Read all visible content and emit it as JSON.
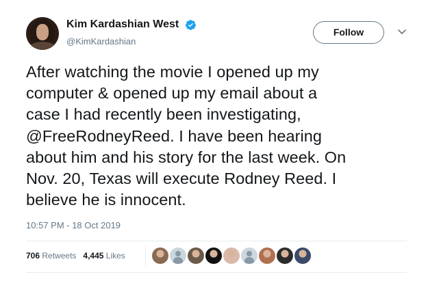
{
  "user": {
    "display_name": "Kim Kardashian West",
    "handle": "@KimKardashian",
    "verified": true
  },
  "follow_button": {
    "label": "Follow"
  },
  "tweet": {
    "lines": [
      "After watching the movie I opened up my",
      "computer & opened up my email about a",
      "case I had recently been investigating,",
      "@FreeRodneyReed. I have been hearing",
      "about him and his story for the last week. On",
      "Nov. 20, Texas will execute Rodney Reed. I",
      "believe he is innocent."
    ],
    "mention": "@FreeRodneyReed",
    "timestamp": "10:57 PM - 18 Oct 2019"
  },
  "stats": {
    "retweets_count": "706",
    "retweets_label": "Retweets",
    "likes_count": "4,445",
    "likes_label": "Likes"
  },
  "likers": [
    {
      "icon": "liker-avatar-1",
      "color": "#8a6a52"
    },
    {
      "icon": "default-avatar-icon",
      "color": "#ccd6dd"
    },
    {
      "icon": "liker-avatar-3",
      "color": "#6b5a4a"
    },
    {
      "icon": "liker-avatar-4",
      "color": "#111111"
    },
    {
      "icon": "liker-avatar-5",
      "color": "#d8b9aa"
    },
    {
      "icon": "default-avatar-icon",
      "color": "#ccd6dd"
    },
    {
      "icon": "liker-avatar-7",
      "color": "#b07050"
    },
    {
      "icon": "liker-avatar-8",
      "color": "#2b2b2b"
    },
    {
      "icon": "liker-avatar-9",
      "color": "#3a4a6a"
    }
  ],
  "colors": {
    "text_primary": "#14171a",
    "text_secondary": "#657786",
    "verified_blue": "#1da1f2",
    "divider": "#e6ecf0"
  }
}
